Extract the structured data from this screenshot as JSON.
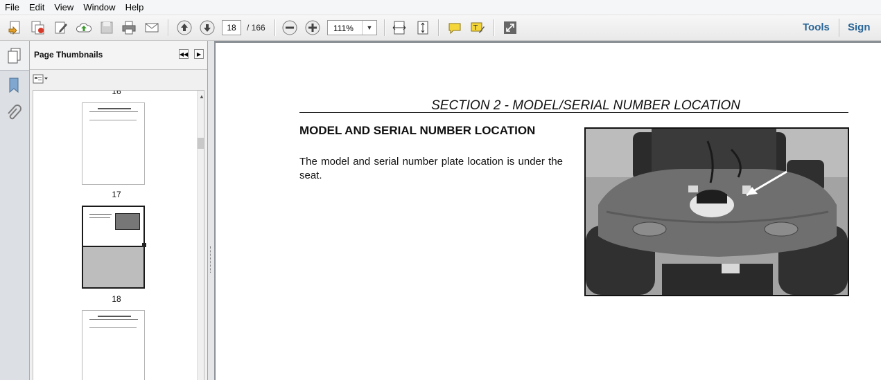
{
  "menu": [
    "File",
    "Edit",
    "View",
    "Window",
    "Help"
  ],
  "toolbar": {
    "current_page": "18",
    "page_total": "/ 166",
    "zoom": "111%",
    "tools_label": "Tools",
    "sign_label": "Sign"
  },
  "icons": {
    "create": "create-pdf-icon",
    "combine": "combine-files-icon",
    "edit": "edit-icon",
    "upload": "upload-cloud-icon",
    "save": "save-icon",
    "print": "print-icon",
    "email": "email-icon",
    "prev": "arrow-up-icon",
    "next": "arrow-down-icon",
    "zoom_out": "minus-circle-icon",
    "zoom_in": "plus-circle-icon",
    "fit_width": "fit-width-icon",
    "fit_page": "fit-page-icon",
    "comment": "comment-icon",
    "highlight": "highlight-text-icon",
    "fullscreen": "fullscreen-icon"
  },
  "panel": {
    "title": "Page Thumbnails",
    "thumbnails": [
      {
        "label": "16"
      },
      {
        "label": "17"
      },
      {
        "label": "18"
      }
    ]
  },
  "document": {
    "section_title": "SECTION 2 - MODEL/SERIAL NUMBER LOCATION",
    "heading": "MODEL AND SERIAL NUMBER LOCATION",
    "paragraph": "The model and serial number plate location is under the seat."
  }
}
